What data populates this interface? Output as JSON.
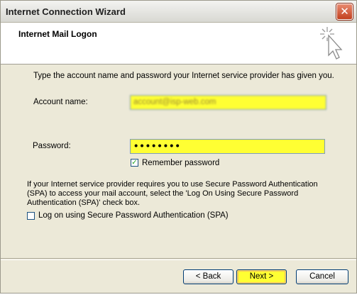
{
  "window": {
    "title": "Internet Connection Wizard",
    "close_glyph": "✕"
  },
  "header": {
    "title": "Internet Mail Logon",
    "icon": "wizard-cursor-icon"
  },
  "intro_text": "Type the account name and password your Internet service provider has given you.",
  "account": {
    "label": "Account name:",
    "value": "account@isp-web.com"
  },
  "password": {
    "label": "Password:",
    "value": "••••••••"
  },
  "remember": {
    "label": "Remember password",
    "checked": true,
    "mark": "✓"
  },
  "spa": {
    "description": "If your Internet service provider requires you to use Secure Password Authentication (SPA) to access your mail account, select the 'Log On Using Secure Password Authentication (SPA)' check box.",
    "checkbox_label": "Log on using Secure Password Authentication (SPA)",
    "checked": false
  },
  "buttons": {
    "back": "< Back",
    "next": "Next >",
    "cancel": "Cancel"
  },
  "colors": {
    "highlight": "#ffff33",
    "dialog_bg": "#ece9d8",
    "close_red": "#c2401f"
  }
}
